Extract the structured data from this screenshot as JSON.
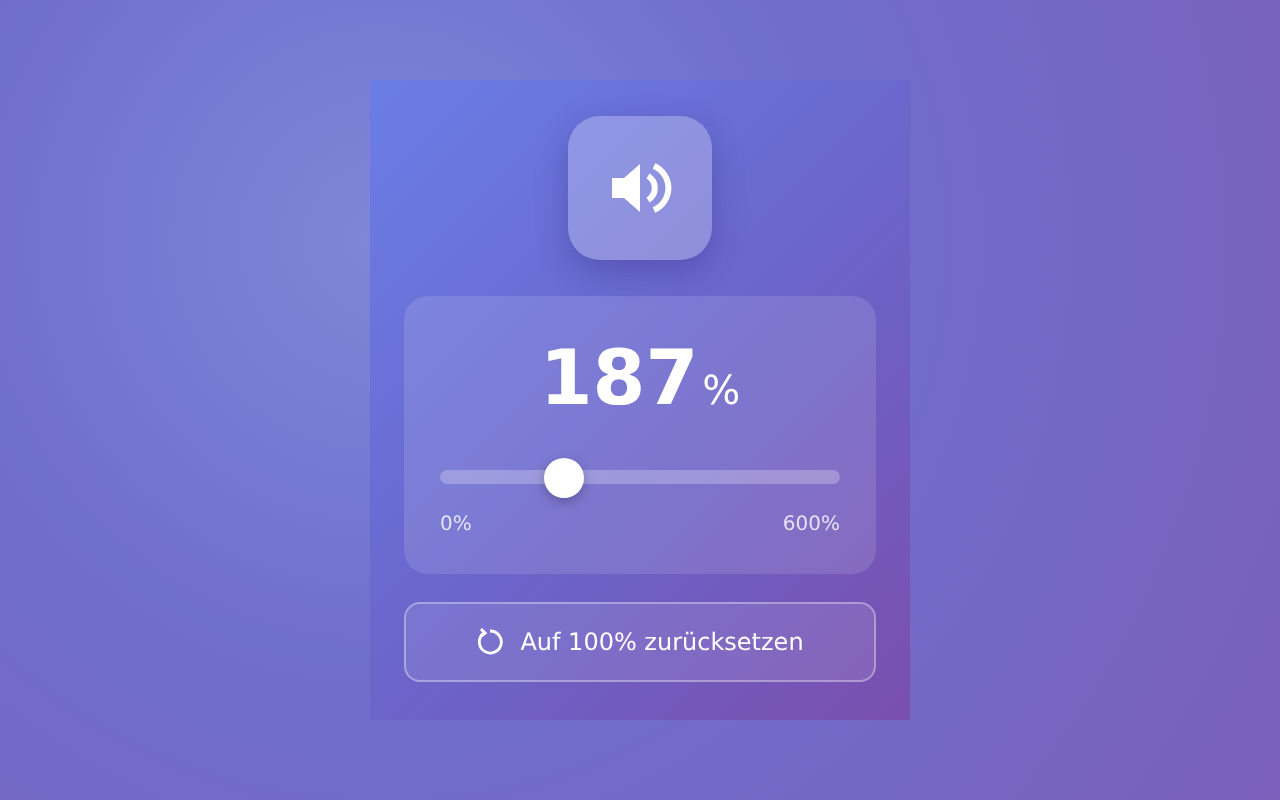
{
  "volume": {
    "value": "187",
    "unit": "%",
    "level": 0.312,
    "min_label": "0%",
    "max_label": "600%"
  },
  "reset_button": {
    "label": "Auf 100% zurücksetzen"
  }
}
